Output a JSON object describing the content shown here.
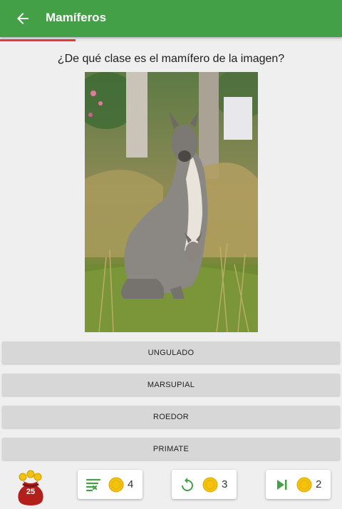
{
  "header": {
    "title": "Mamíferos",
    "back_icon": "arrow-left-icon",
    "color": "#43a047"
  },
  "progress": {
    "fraction": 0.22,
    "color": "#e53935"
  },
  "question": {
    "text": "¿De qué clase es el mamífero de la imagen?"
  },
  "image": {
    "subject": "kangaroo with joey in pouch"
  },
  "answers": [
    {
      "label": "UNGULADO"
    },
    {
      "label": "MARSUPIAL"
    },
    {
      "label": "ROEDOR"
    },
    {
      "label": "PRIMATE"
    }
  ],
  "footer": {
    "coins_bag": {
      "count": "25",
      "icon": "coin-bag-icon"
    },
    "powerups": [
      {
        "icon": "eliminate-answers-icon",
        "cost": "4"
      },
      {
        "icon": "retry-icon",
        "cost": "3"
      },
      {
        "icon": "skip-icon",
        "cost": "2"
      }
    ]
  }
}
